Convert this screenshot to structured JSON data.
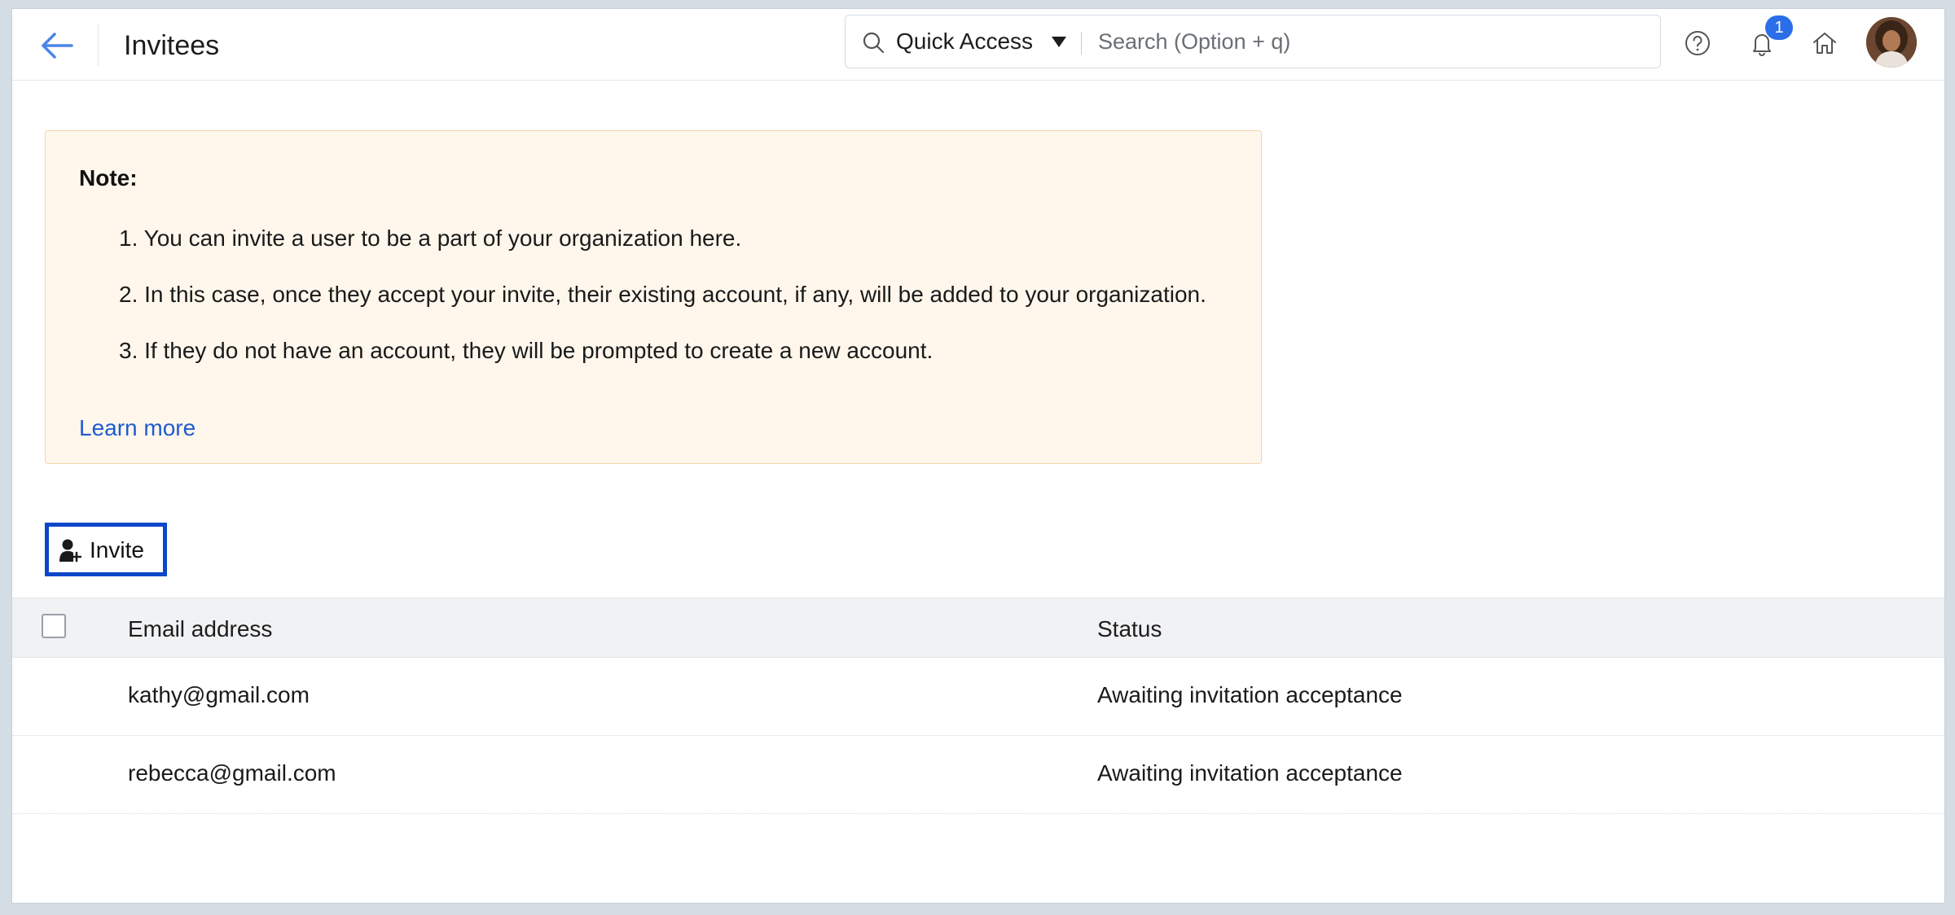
{
  "header": {
    "title": "Invitees",
    "quick_access_label": "Quick Access",
    "search_placeholder": "Search (Option + q)",
    "notification_count": "1"
  },
  "note": {
    "title": "Note:",
    "items": [
      "1. You can invite a user to be a part of your organization here.",
      "2. In this case, once they accept your invite, their existing account, if any, will be added to your organization.",
      "3. If they do not have an account, they will be prompted to create a new account."
    ],
    "learn_more": "Learn more"
  },
  "invite_button_label": "Invite",
  "table": {
    "columns": [
      "Email address",
      "Status"
    ],
    "rows": [
      {
        "email": "kathy@gmail.com",
        "status": "Awaiting invitation acceptance"
      },
      {
        "email": "rebecca@gmail.com",
        "status": "Awaiting invitation acceptance"
      }
    ]
  },
  "colors": {
    "accent": "#1f5bd0",
    "invite_border": "#0c47c9",
    "note_background": "#fff7ec",
    "badge": "#2b6ee8"
  },
  "icons": [
    "back-arrow-icon",
    "search-icon",
    "help-icon",
    "bell-icon",
    "home-icon",
    "add-user-icon"
  ]
}
